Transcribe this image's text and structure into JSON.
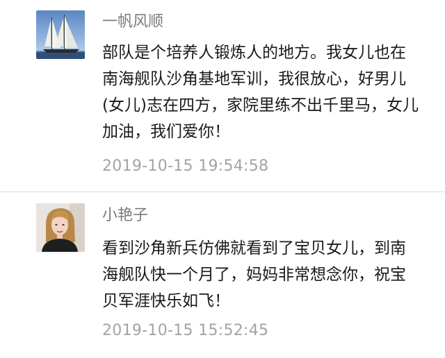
{
  "comments": [
    {
      "avatar_icon": "sailing-ship-avatar",
      "username": "一帆风顺",
      "lines": [
        "部队是个培养人锻炼人的地方。我女儿也在",
        "南海舰队沙角基地军训，我很放心，好男儿",
        "(女儿)志在四方，家院里练不出千里马，女儿",
        "加油，我们爱你！"
      ],
      "timestamp": "2019-10-15 19:54:58"
    },
    {
      "avatar_icon": "woman-portrait-avatar",
      "username": "小艳子",
      "lines": [
        "看到沙角新兵仿佛就看到了宝贝女儿，到南",
        "海舰队快一个月了，妈妈非常想念你，祝宝",
        "贝军涯快乐如飞！"
      ],
      "timestamp": "2019-10-15 15:52:45"
    }
  ],
  "colors": {
    "username": "#7a7a7a",
    "content": "#1a1a1a",
    "timestamp": "#a3a3a3",
    "divider": "#dcdcdc"
  }
}
